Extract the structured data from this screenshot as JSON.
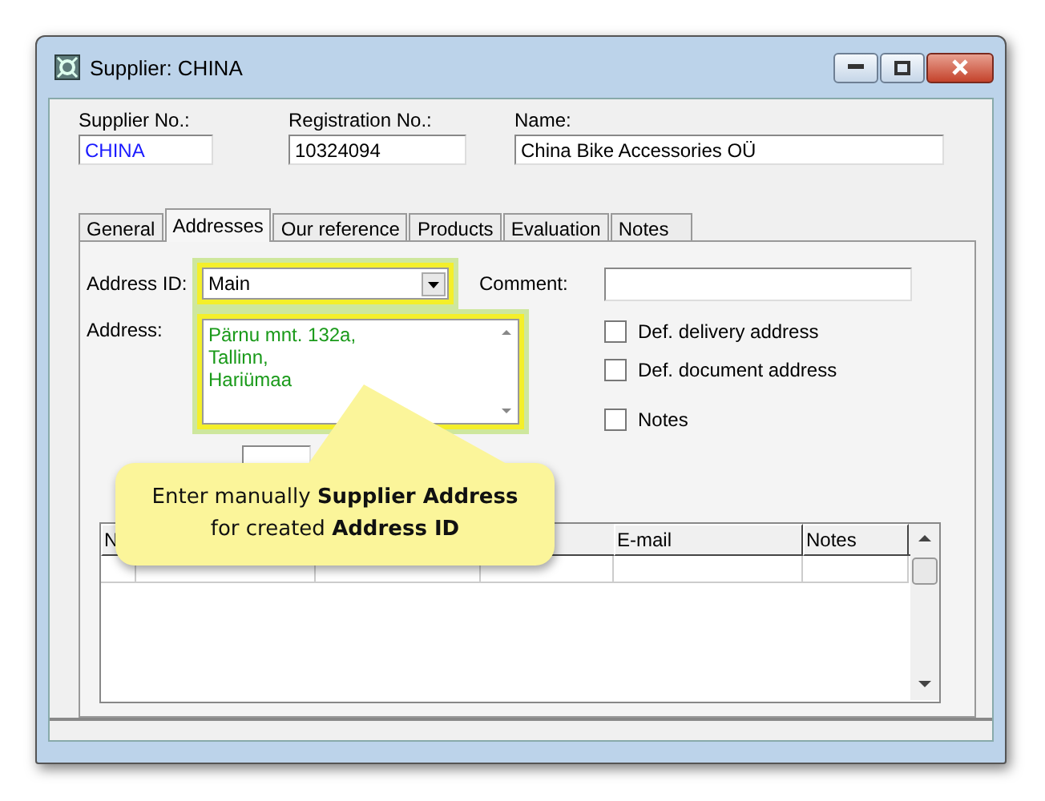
{
  "window": {
    "title": "Supplier: CHINA"
  },
  "header_fields": [
    {
      "label": "Supplier No.:",
      "value": "CHINA",
      "kind": "key"
    },
    {
      "label": "Registration No.:",
      "value": "10324094",
      "kind": "plain"
    },
    {
      "label": "Name:",
      "value": "China Bike Accessories OÜ",
      "kind": "plain"
    }
  ],
  "tabs": [
    {
      "label": "General",
      "selected": false
    },
    {
      "label": "Addresses",
      "selected": true
    },
    {
      "label": "Our reference",
      "selected": false
    },
    {
      "label": "Products",
      "selected": false
    },
    {
      "label": "Evaluation",
      "selected": false
    },
    {
      "label": "Notes",
      "selected": false
    }
  ],
  "address_id": {
    "label": "Address ID:",
    "value": "Main",
    "highlighted": true
  },
  "comment": {
    "label": "Comment:"
  },
  "address": {
    "label": "Address:",
    "value": "Pärnu mnt. 132a,\nTallinn,\nHariümaa",
    "highlighted": true
  },
  "checkboxes": [
    {
      "label": "Def. delivery address",
      "checked": false
    },
    {
      "label": "Def. document address",
      "checked": false
    },
    {
      "label": "Notes",
      "checked": false
    }
  ],
  "table": {
    "columns": [
      {
        "label": "N"
      },
      {},
      {},
      {},
      {
        "label": "E-mail"
      },
      {
        "label": "Notes"
      }
    ]
  },
  "callout": {
    "lines": [
      "Enter manually **Supplier Address**",
      "for created **Address ID**"
    ]
  }
}
